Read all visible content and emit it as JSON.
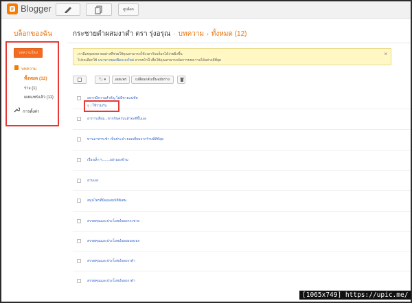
{
  "app": {
    "logo_text": "Blogger"
  },
  "top_toolbar": {
    "view_blog_label": "ดูบล็อก"
  },
  "sidebar": {
    "title": "บล็อกของฉัน",
    "new_post_label": "บทความใหม่",
    "items": [
      {
        "label": "บทความ"
      },
      {
        "label": "ทั้งหมด (12)"
      },
      {
        "label": "ร่าง (1)"
      },
      {
        "label": "เผยแพร่แล้ว (11)"
      },
      {
        "label": "การตั้งค่า"
      }
    ]
  },
  "header": {
    "blog_name": "กระชายดำผสมงาดำ ตรา รุ่งอรุณ",
    "section": "บทความ",
    "filter": "ทั้งหมด (12)"
  },
  "notice": {
    "line1": "เรามีเหตุผลหลายอย่างที่ช่วยให้คุณสามารถใช้เวลากับบล็อกได้ง่ายยิ่งขึ้น",
    "line2_prefix": "โปรดเลือกใช้",
    "line2_link": "แนวทางของฟีดแบบใหม่",
    "line2_suffix": "จากหน้านี้ เพื่อให้คุณสามารถจัดการบทความได้อย่างดีที่สุด",
    "close": "×"
  },
  "toolbar": {
    "label_btn": "🏷 ▾",
    "publish_label": "เผยแพร่",
    "revert_label": "เปลี่ยนกลับเป็นฉบับร่าง",
    "delete_icon": "trash-icon"
  },
  "posts": [
    {
      "title": "อยากมีความสำคัญ ไม่มีชายแน่ชัด"
    },
    {
      "title": "อาการเสื่อม...หากกินครบแล้วจะดีขึ้นเอง"
    },
    {
      "title": "ทานอาหารเช้า เป็นประจำ ยอดเยี่ยมจากร้านที่ดีที่สุด"
    },
    {
      "title": "เรื่องเล็ก ๆ........อย่ามองข้าม"
    },
    {
      "title": "อ่านเอง"
    },
    {
      "title": "สมุนไพรที่มีคุณสมบัติพิเศษ"
    },
    {
      "title": "สรรพคุณและประโยชน์ของกระชาย"
    },
    {
      "title": "สรรพคุณและประโยชน์ของผมหงอก"
    },
    {
      "title": "สรรพคุณและประโยชน์ของงาดำ"
    },
    {
      "title": "สรรพคุณและประโยชน์ของงาดำ"
    }
  ],
  "first_post_actions": {
    "view_label": "ดู",
    "sep": "|",
    "share_label": "ใช้ร่วมกัน"
  },
  "caption": "[1065x749] https://upic.me/",
  "colors": {
    "accent_orange": "#f57d00",
    "link_blue": "#3366cc",
    "highlight_red": "#e53935",
    "notice_bg": "#fff8c5"
  }
}
